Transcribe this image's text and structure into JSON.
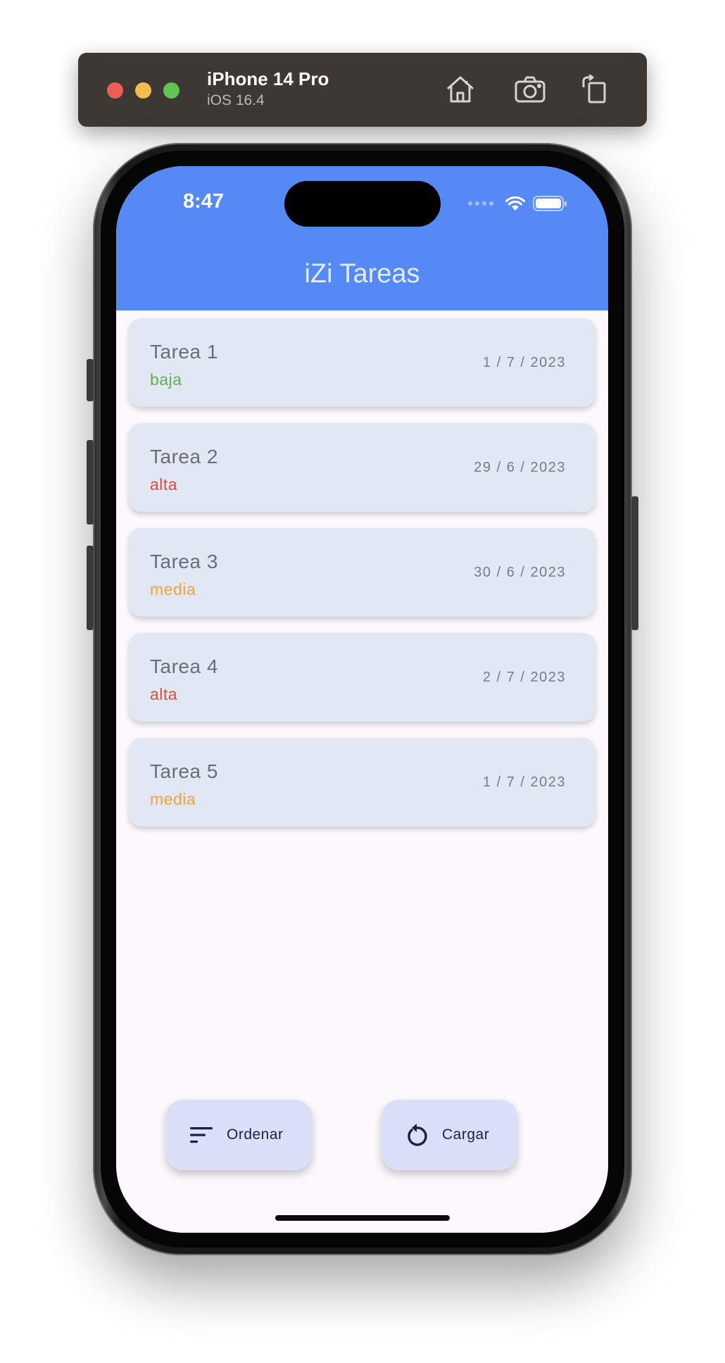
{
  "simulator": {
    "device_name": "iPhone 14 Pro",
    "os_version": "iOS 16.4",
    "buttons": {
      "home_icon": "home-icon",
      "screenshot_icon": "camera-icon",
      "rotate_icon": "rotate-icon"
    }
  },
  "status_bar": {
    "time": "8:47"
  },
  "app": {
    "title": "iZi Tareas",
    "header_color": "#5589f5"
  },
  "tasks": [
    {
      "title": "Tarea 1",
      "priority": "baja",
      "priority_color": "#5fae58",
      "date": "1 / 7 / 2023"
    },
    {
      "title": "Tarea 2",
      "priority": "alta",
      "priority_color": "#de4c3f",
      "date": "29 / 6 / 2023"
    },
    {
      "title": "Tarea 3",
      "priority": "media",
      "priority_color": "#efa43c",
      "date": "30 / 6 / 2023"
    },
    {
      "title": "Tarea 4",
      "priority": "alta",
      "priority_color": "#de4c3f",
      "date": "2 / 7 / 2023"
    },
    {
      "title": "Tarea 5",
      "priority": "media",
      "priority_color": "#efa43c",
      "date": "1 / 7 / 2023"
    }
  ],
  "actions": {
    "sort_label": "Ordenar",
    "sort_icon": "sort-icon",
    "load_label": "Cargar",
    "load_icon": "refresh-icon"
  }
}
